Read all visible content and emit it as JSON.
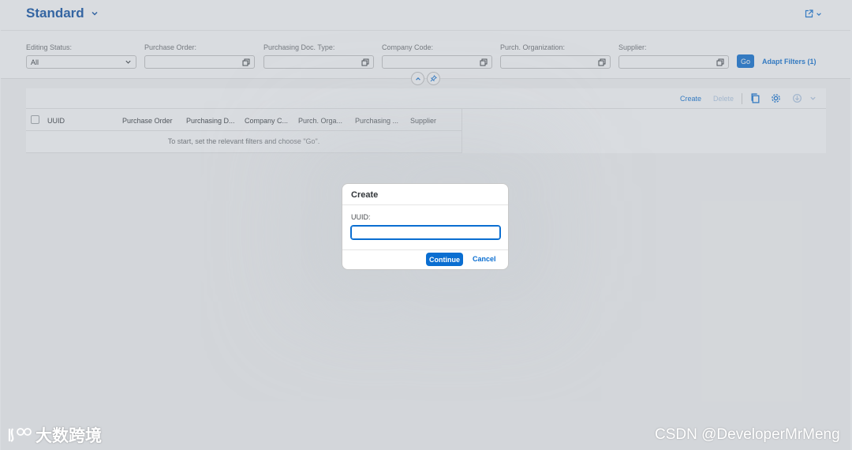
{
  "header": {
    "variant_title": "Standard",
    "variant_icon": "chevron-down-icon",
    "share_icon": "share-icon"
  },
  "filters": [
    {
      "label": "Editing Status:",
      "value": "All",
      "type": "select"
    },
    {
      "label": "Purchase Order:",
      "value": "",
      "type": "valuehelp"
    },
    {
      "label": "Purchasing Doc. Type:",
      "value": "",
      "type": "valuehelp"
    },
    {
      "label": "Company Code:",
      "value": "",
      "type": "valuehelp"
    },
    {
      "label": "Purch. Organization:",
      "value": "",
      "type": "valuehelp"
    },
    {
      "label": "Supplier:",
      "value": "",
      "type": "valuehelp"
    }
  ],
  "filterbar": {
    "go_label": "Go",
    "adapt_label": "Adapt Filters (1)"
  },
  "table": {
    "toolbar": {
      "create_label": "Create",
      "delete_label": "Delete"
    },
    "columns": [
      "UUID",
      "Purchase Order",
      "Purchasing D...",
      "Company C...",
      "Purch. Orga...",
      "Purchasing ...",
      "Supplier"
    ],
    "empty_text": "To start, set the relevant filters and choose \"Go\"."
  },
  "dialog": {
    "title": "Create",
    "field_label": "UUID:",
    "field_value": "",
    "continue_label": "Continue",
    "cancel_label": "Cancel"
  },
  "watermark": {
    "left": "大数跨境",
    "right": "CSDN @DeveloperMrMeng"
  },
  "colors": {
    "brand_blue": "#0a6ed1",
    "title_blue": "#0a4ea3"
  }
}
